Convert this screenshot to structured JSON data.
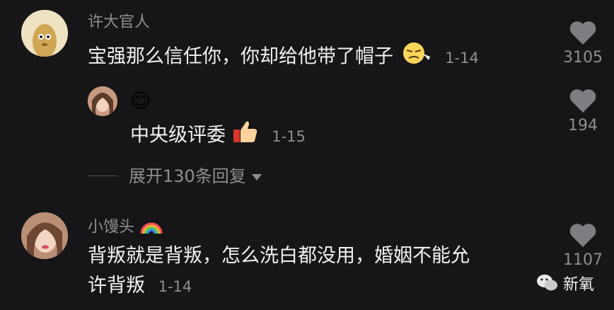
{
  "comments": [
    {
      "username": "许大官人",
      "text": "宝强那么信任你，你却给他带了帽子",
      "emoji": "smirk-emoji",
      "date": "1-14",
      "likes": "3105"
    },
    {
      "reply_emoji": "😊",
      "username_emoji": "smile-emoji",
      "text": "中央级评委",
      "emoji": "thumbs-up-emoji",
      "date": "1-15",
      "likes": "194"
    },
    {
      "username": "小馒头",
      "username_emoji": "rainbow-emoji",
      "text_line1": "背叛就是背叛，怎么洗白都没用，婚姻不能允",
      "text_line2": "许背叛",
      "date": "1-14",
      "likes": "1107"
    }
  ],
  "expand_replies": "展开130条回复",
  "watermark": "新氧",
  "colors": {
    "background": "#161618",
    "text": "#f2f2f2",
    "muted": "#8e8e93"
  }
}
